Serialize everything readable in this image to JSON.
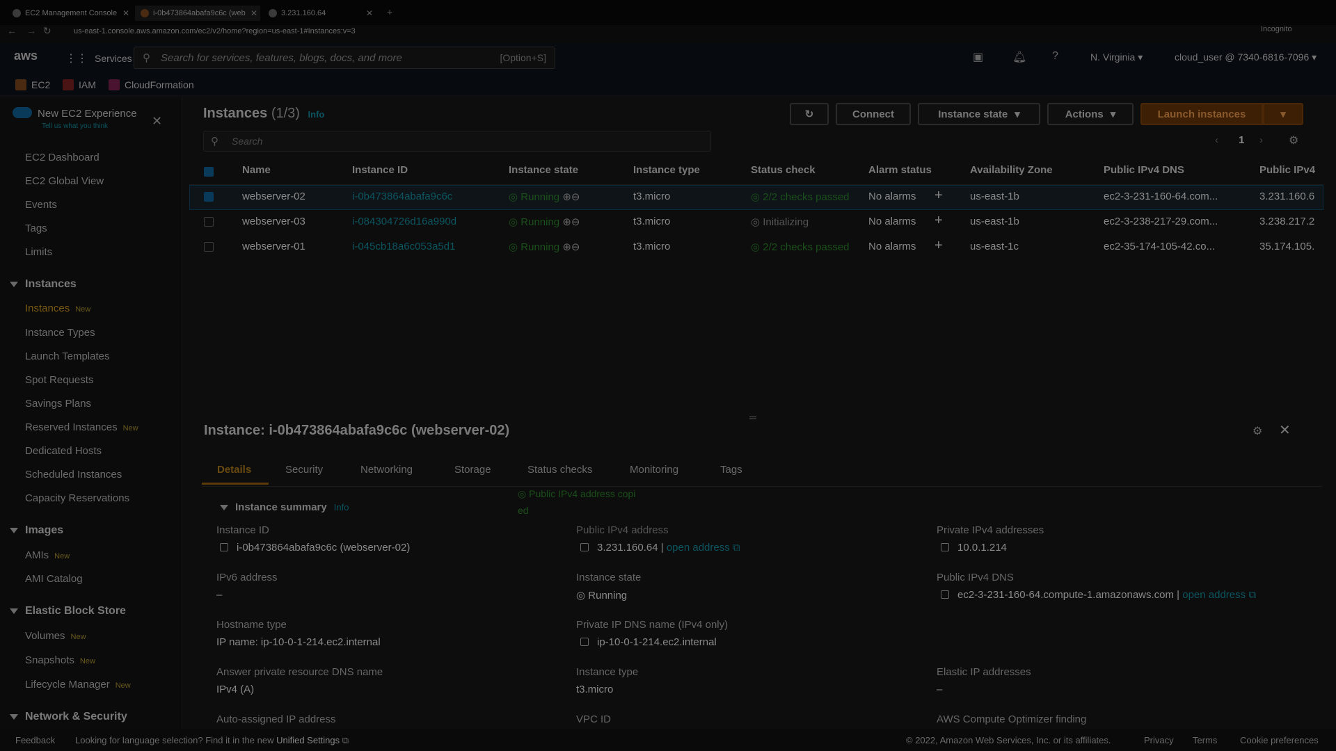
{
  "browser": {
    "tabs": [
      {
        "label": "EC2 Management Console"
      },
      {
        "label": "i-0b473864abafa9c6c (web"
      },
      {
        "label": "3.231.160.64"
      }
    ],
    "url": "us-east-1.console.aws.amazon.com/ec2/v2/home?region=us-east-1#Instances:v=3"
  },
  "topnav": {
    "services": "Services",
    "search_placeholder": "Search for services, features, blogs, docs, and more",
    "search_shortcut": "[Option+S]",
    "region": "N. Virginia",
    "account": "cloud_user @ 7340-6816-7096",
    "incognito": "Incognito"
  },
  "favorites": [
    "EC2",
    "IAM",
    "CloudFormation"
  ],
  "sidebar": {
    "new_experience": "New EC2 Experience",
    "tell_us": "Tell us what you think",
    "top_items": [
      "EC2 Dashboard",
      "EC2 Global View",
      "Events",
      "Tags",
      "Limits"
    ],
    "instances_section": "Instances",
    "instances_items": [
      "Instances",
      "Instance Types",
      "Launch Templates",
      "Spot Requests",
      "Savings Plans",
      "Reserved Instances",
      "Dedicated Hosts",
      "Scheduled Instances",
      "Capacity Reservations"
    ],
    "images_section": "Images",
    "images_items": [
      "AMIs",
      "AMI Catalog"
    ],
    "ebs_section": "Elastic Block Store",
    "ebs_items": [
      "Volumes",
      "Snapshots",
      "Lifecycle Manager"
    ],
    "network_section": "Network & Security",
    "new_badge": "New"
  },
  "instances": {
    "title": "Instances",
    "count": "(1/3)",
    "info": "Info",
    "connect": "Connect",
    "instance_state": "Instance state",
    "actions": "Actions",
    "launch": "Launch instances",
    "search_placeholder": "Search",
    "page": "1",
    "columns": [
      "Name",
      "Instance ID",
      "Instance state",
      "Instance type",
      "Status check",
      "Alarm status",
      "Availability Zone",
      "Public IPv4 DNS",
      "Public IPv4"
    ],
    "rows": [
      {
        "name": "webserver-02",
        "id": "i-0b473864abafa9c6c",
        "state": "Running",
        "type": "t3.micro",
        "status": "2/2 checks passed",
        "alarm": "No alarms",
        "az": "us-east-1b",
        "dns": "ec2-3-231-160-64.com...",
        "ip": "3.231.160.6",
        "selected": true
      },
      {
        "name": "webserver-03",
        "id": "i-084304726d16a990d",
        "state": "Running",
        "type": "t3.micro",
        "status": "Initializing",
        "alarm": "No alarms",
        "az": "us-east-1b",
        "dns": "ec2-3-238-217-29.com...",
        "ip": "3.238.217.2",
        "selected": false
      },
      {
        "name": "webserver-01",
        "id": "i-045cb18a6c053a5d1",
        "state": "Running",
        "type": "t3.micro",
        "status": "2/2 checks passed",
        "alarm": "No alarms",
        "az": "us-east-1c",
        "dns": "ec2-35-174-105-42.co...",
        "ip": "35.174.105.",
        "selected": false
      }
    ]
  },
  "details": {
    "title": "Instance: i-0b473864abafa9c6c (webserver-02)",
    "tabs": [
      "Details",
      "Security",
      "Networking",
      "Storage",
      "Status checks",
      "Monitoring",
      "Tags"
    ],
    "summary": "Instance summary",
    "info": "Info",
    "copied_line1": "Public IPv4 address copi",
    "copied_line2": "ed",
    "fields": {
      "instance_id_label": "Instance ID",
      "instance_id": "i-0b473864abafa9c6c (webserver-02)",
      "public_ip_label": "Public IPv4 address",
      "public_ip": "3.231.160.64",
      "open_address": "open address",
      "private_ip_label": "Private IPv4 addresses",
      "private_ip": "10.0.1.214",
      "ipv6_label": "IPv6 address",
      "ipv6": "–",
      "state_label": "Instance state",
      "state": "Running",
      "public_dns_label": "Public IPv4 DNS",
      "public_dns": "ec2-3-231-160-64.compute-1.amazonaws.com",
      "hostname_label": "Hostname type",
      "hostname": "IP name: ip-10-0-1-214.ec2.internal",
      "private_dns_label": "Private IP DNS name (IPv4 only)",
      "private_dns": "ip-10-0-1-214.ec2.internal",
      "answer_label": "Answer private resource DNS name",
      "answer": "IPv4 (A)",
      "type_label": "Instance type",
      "type": "t3.micro",
      "eip_label": "Elastic IP addresses",
      "eip": "–",
      "auto_ip_label": "Auto-assigned IP address",
      "vpc_label": "VPC ID",
      "optimizer_label": "AWS Compute Optimizer finding"
    }
  },
  "footer": {
    "feedback": "Feedback",
    "language": "Looking for language selection? Find it in the new",
    "unified": "Unified Settings",
    "copyright": "© 2022, Amazon Web Services, Inc. or its affiliates.",
    "privacy": "Privacy",
    "terms": "Terms",
    "cookies": "Cookie preferences"
  }
}
